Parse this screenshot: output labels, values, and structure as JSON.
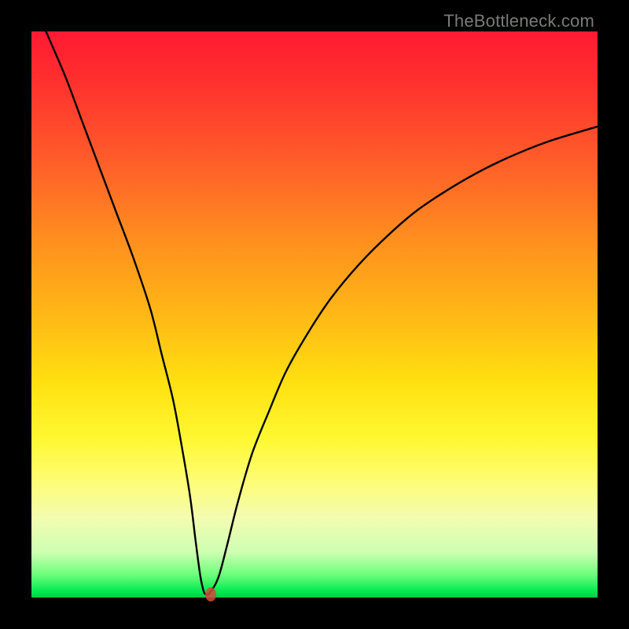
{
  "watermark": "TheBottleneck.com",
  "chart_data": {
    "type": "line",
    "title": "",
    "xlabel": "",
    "ylabel": "",
    "xlim": [
      0,
      100
    ],
    "ylim": [
      0,
      100
    ],
    "grid": false,
    "series": [
      {
        "name": "bottleneck-curve",
        "x": [
          0,
          3,
          6,
          9,
          12,
          15,
          18,
          21,
          23,
          25,
          26.5,
          28,
          29,
          29.8,
          30.4,
          30.8,
          31.5,
          33,
          34.5,
          36.5,
          39,
          42,
          45,
          49,
          53,
          58,
          63,
          68,
          74,
          80,
          86,
          92,
          100
        ],
        "y": [
          106,
          99,
          92,
          84,
          76,
          68,
          60,
          51,
          43,
          35,
          27,
          18,
          10,
          4,
          1.2,
          0.6,
          0.8,
          3.5,
          9,
          17,
          25.5,
          33,
          40,
          47,
          53,
          59,
          64,
          68.3,
          72.3,
          75.7,
          78.5,
          80.8,
          83.2
        ]
      }
    ],
    "marker": {
      "x": 31.6,
      "y": 0.6,
      "color": "#d44a3a"
    },
    "colors": {
      "curve": "#000000",
      "frame": "#000000",
      "gradient_top": "#ff1a33",
      "gradient_bottom": "#00cc44"
    }
  }
}
